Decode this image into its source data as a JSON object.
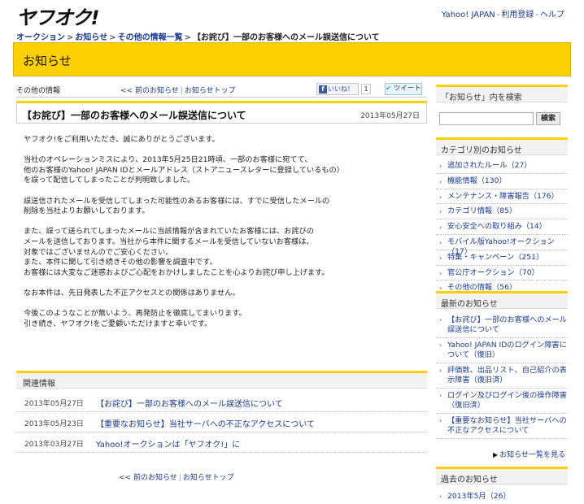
{
  "header": {
    "logo": "ヤフオク!",
    "links": [
      "Yahoo! JAPAN",
      "利用登録",
      "ヘルプ"
    ]
  },
  "breadcrumb": {
    "items": [
      "オークション",
      "お知らせ",
      "その他の情報一覧"
    ],
    "current": "【お詫び】一部のお客様へのメール誤送信について"
  },
  "banner": {
    "title": "お知らせ"
  },
  "subhead": {
    "label": "その他の情報",
    "prev": "<< 前のお知らせ",
    "top": "お知らせトップ",
    "like": "いいね！",
    "like_icon": "f",
    "like_count": "1",
    "tweet": "ツイート",
    "tweet_icon": "✔"
  },
  "article": {
    "title": "【お詫び】一部のお客様へのメール誤送信について",
    "date": "2013年05月27日",
    "paragraphs": [
      [
        "ヤフオク!をご利用いただき、誠にありがとうございます。"
      ],
      [
        "当社のオペレーションミスにより、2013年5月25日21時頃、一部のお客様に宛てて、",
        "他のお客様のYahoo! JAPAN IDとメールアドレス（ストアニュースレターに登録しているもの）",
        "を誤って配信してしまったことが判明致しました。"
      ],
      [
        "誤送信されたメールを受信してしまった可能性のあるお客様には、すでに受信したメールの",
        "削除を当社よりお願いしております。"
      ],
      [
        "また、誤って送られてしまったメールに当該情報が含まれていたお客様には、お詫びの",
        "メールを送信しております。当社から本件に関するメールを受信していないお客様は、",
        "対象ではございませんのでご安心ください。",
        "また、本件に関して引き続きその他の影響を調査中です。",
        "お客様には大変なご迷惑およびご心配をおかけしましたことを心よりお詫び申し上げます。"
      ],
      [
        "なお本件は、先日発表した不正アクセスとの関係はありません。"
      ],
      [
        "今後このようなことが無いよう、再発防止を徹底してまいります。",
        "引き続き、ヤフオク!をご愛顧いただけますと幸いです。"
      ]
    ]
  },
  "related": {
    "heading": "関連情報",
    "rows": [
      {
        "date": "2013年05月27日",
        "title": "【お詫び】一部のお客様へのメール誤送信について"
      },
      {
        "date": "2013年05月23日",
        "title": "【重要なお知らせ】当社サーバへの不正なアクセスについて"
      },
      {
        "date": "2013年03月27日",
        "title": "Yahoo!オークションは「ヤフオク!」に"
      }
    ]
  },
  "bottom_nav": {
    "prev": "<< 前のお知らせ",
    "top": "お知らせトップ"
  },
  "sidebar": {
    "search_heading": "「お知らせ」内を検索",
    "search_button": "検索",
    "category_heading": "カテゴリ別のお知らせ",
    "categories": [
      "追加されたルール（27）",
      "機能情報（130）",
      "メンテナンス・障害報告（176）",
      "カテゴリ情報（85）",
      "安心安全への取り組み（14）",
      "モバイル版Yahoo!オークション（17）",
      "特集・キャンペーン（251）",
      "官公庁オークション（70）",
      "その他の情報（56）"
    ],
    "latest_heading": "最新のお知らせ",
    "latest": [
      [
        "【お詫び】一部のお客様へのメール",
        "誤送信について"
      ],
      [
        "Yahoo! JAPAN IDのログイン障害に",
        "ついて（復旧）"
      ],
      [
        "評価数、出品リスト、自己紹介の表",
        "示障害（復旧済）"
      ],
      [
        "ログイン及びログイン後の操作障害",
        "（復旧済）"
      ],
      [
        "【重要なお知らせ】当社サーバへの",
        "不正なアクセスについて"
      ]
    ],
    "more": "お知らせ一覧を見る",
    "past_heading": "過去のお知らせ",
    "past": [
      "2013年5月（26）"
    ]
  }
}
